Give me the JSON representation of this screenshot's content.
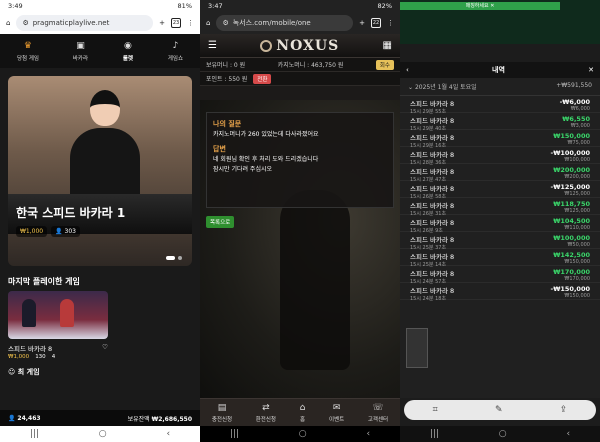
{
  "phone1": {
    "status": {
      "time": "3:49",
      "battery": "81%"
    },
    "url": "pragmaticplaylive.net",
    "tab_count": "23",
    "categories": [
      {
        "label": "당첨 게임",
        "icon": "trophy-icon"
      },
      {
        "label": "바카라",
        "icon": "cards-icon"
      },
      {
        "label": "룰렛",
        "icon": "roulette-icon"
      },
      {
        "label": "게임쇼",
        "icon": "microphone-icon"
      }
    ],
    "hero": {
      "title": "한국 스피드 바카라 1",
      "bet": "₩1,000",
      "players": "303"
    },
    "section_title": "마지막 플레이한 게임",
    "card": {
      "title": "스피드 바카라 8",
      "bet": "₩1,000",
      "players": "130",
      "extra": "4"
    },
    "more_title": "최 게임",
    "footer": {
      "online": "24,463",
      "balance_label": "보유잔액",
      "balance": "₩2,686,550"
    }
  },
  "phone2": {
    "status": {
      "time": "3:47",
      "battery": "82%"
    },
    "url": "녹서스.com/mobile/one",
    "tab_count": "22",
    "logo": "NOXUS",
    "money": {
      "bet_label": "보유머니 : 0 원",
      "casino_label": "카지노머니 : 463,750 원",
      "btn": "회수",
      "point_label": "포인트 : 550 원",
      "point_btn": "전환"
    },
    "panel": {
      "q_title": "나의 질문",
      "q_text": "카지노머니가 260 있었는데 다사라졌어요",
      "a_title": "답변",
      "a_text": "네 회원님 확인 후 처리 도와 드리겠습니다",
      "a_text2": "잠시만 기다려 주십시오"
    },
    "back_label": "목록으로",
    "bottom_nav": [
      {
        "label": "충전신청",
        "icon": "wallet-icon"
      },
      {
        "label": "환전신청",
        "icon": "exchange-icon"
      },
      {
        "label": "홈",
        "icon": "home-icon"
      },
      {
        "label": "이벤트",
        "icon": "gift-icon"
      },
      {
        "label": "고객센터",
        "icon": "support-icon"
      }
    ]
  },
  "phone3": {
    "top_banner": "매칭하세요 ✕",
    "sheet_title": "내역",
    "date_row": {
      "date": "2025년 1월 4일 토요일",
      "total": "+₩591,550"
    },
    "rows": [
      {
        "name": "스피드 바카라 8",
        "time": "15시 29분 55초",
        "amount": "-₩6,000",
        "bet": "₩6,000",
        "positive": false
      },
      {
        "name": "스피드 바카라 8",
        "time": "15시 29분 40초",
        "amount": "₩6,550",
        "bet": "₩3,000",
        "positive": true
      },
      {
        "name": "스피드 바카라 8",
        "time": "15시 29분 16초",
        "amount": "₩150,000",
        "bet": "₩75,000",
        "positive": true
      },
      {
        "name": "스피드 바카라 8",
        "time": "15시 28분 36초",
        "amount": "-₩100,000",
        "bet": "₩100,000",
        "positive": false
      },
      {
        "name": "스피드 바카라 8",
        "time": "15시 27분 47초",
        "amount": "₩200,000",
        "bet": "₩200,000",
        "positive": true
      },
      {
        "name": "스피드 바카라 8",
        "time": "15시 26분 58초",
        "amount": "-₩125,000",
        "bet": "₩125,000",
        "positive": false
      },
      {
        "name": "스피드 바카라 8",
        "time": "15시 26분 31초",
        "amount": "₩118,750",
        "bet": "₩125,000",
        "positive": true
      },
      {
        "name": "스피드 바카라 8",
        "time": "15시 26분 9초",
        "amount": "₩104,500",
        "bet": "₩110,000",
        "positive": true
      },
      {
        "name": "스피드 바카라 8",
        "time": "15시 25분 37초",
        "amount": "₩100,000",
        "bet": "₩50,000",
        "positive": true
      },
      {
        "name": "스피드 바카라 8",
        "time": "15시 25분 14초",
        "amount": "₩142,500",
        "bet": "₩150,000",
        "positive": true
      },
      {
        "name": "스피드 바카라 8",
        "time": "15시 24분 57초",
        "amount": "₩170,000",
        "bet": "₩170,000",
        "positive": true
      },
      {
        "name": "스피드 바카라 8",
        "time": "15시 24분 18초",
        "amount": "-₩150,000",
        "bet": "₩150,000",
        "positive": false
      }
    ]
  },
  "colors": {
    "positive": "#3ad66a",
    "gold": "#f3c34b",
    "accent_green": "#2fa04a"
  }
}
